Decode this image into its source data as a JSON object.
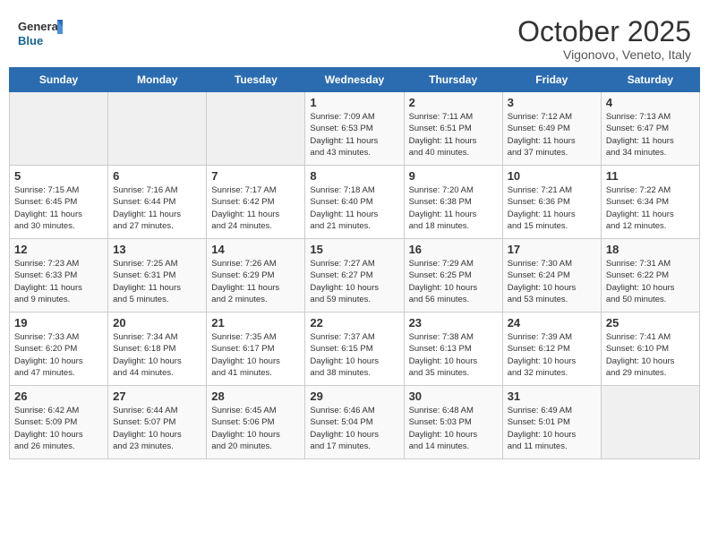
{
  "logo": {
    "line1": "General",
    "line2": "Blue"
  },
  "title": "October 2025",
  "subtitle": "Vigonovo, Veneto, Italy",
  "days_of_week": [
    "Sunday",
    "Monday",
    "Tuesday",
    "Wednesday",
    "Thursday",
    "Friday",
    "Saturday"
  ],
  "weeks": [
    [
      {
        "day": "",
        "info": ""
      },
      {
        "day": "",
        "info": ""
      },
      {
        "day": "",
        "info": ""
      },
      {
        "day": "1",
        "info": "Sunrise: 7:09 AM\nSunset: 6:53 PM\nDaylight: 11 hours\nand 43 minutes."
      },
      {
        "day": "2",
        "info": "Sunrise: 7:11 AM\nSunset: 6:51 PM\nDaylight: 11 hours\nand 40 minutes."
      },
      {
        "day": "3",
        "info": "Sunrise: 7:12 AM\nSunset: 6:49 PM\nDaylight: 11 hours\nand 37 minutes."
      },
      {
        "day": "4",
        "info": "Sunrise: 7:13 AM\nSunset: 6:47 PM\nDaylight: 11 hours\nand 34 minutes."
      }
    ],
    [
      {
        "day": "5",
        "info": "Sunrise: 7:15 AM\nSunset: 6:45 PM\nDaylight: 11 hours\nand 30 minutes."
      },
      {
        "day": "6",
        "info": "Sunrise: 7:16 AM\nSunset: 6:44 PM\nDaylight: 11 hours\nand 27 minutes."
      },
      {
        "day": "7",
        "info": "Sunrise: 7:17 AM\nSunset: 6:42 PM\nDaylight: 11 hours\nand 24 minutes."
      },
      {
        "day": "8",
        "info": "Sunrise: 7:18 AM\nSunset: 6:40 PM\nDaylight: 11 hours\nand 21 minutes."
      },
      {
        "day": "9",
        "info": "Sunrise: 7:20 AM\nSunset: 6:38 PM\nDaylight: 11 hours\nand 18 minutes."
      },
      {
        "day": "10",
        "info": "Sunrise: 7:21 AM\nSunset: 6:36 PM\nDaylight: 11 hours\nand 15 minutes."
      },
      {
        "day": "11",
        "info": "Sunrise: 7:22 AM\nSunset: 6:34 PM\nDaylight: 11 hours\nand 12 minutes."
      }
    ],
    [
      {
        "day": "12",
        "info": "Sunrise: 7:23 AM\nSunset: 6:33 PM\nDaylight: 11 hours\nand 9 minutes."
      },
      {
        "day": "13",
        "info": "Sunrise: 7:25 AM\nSunset: 6:31 PM\nDaylight: 11 hours\nand 5 minutes."
      },
      {
        "day": "14",
        "info": "Sunrise: 7:26 AM\nSunset: 6:29 PM\nDaylight: 11 hours\nand 2 minutes."
      },
      {
        "day": "15",
        "info": "Sunrise: 7:27 AM\nSunset: 6:27 PM\nDaylight: 10 hours\nand 59 minutes."
      },
      {
        "day": "16",
        "info": "Sunrise: 7:29 AM\nSunset: 6:25 PM\nDaylight: 10 hours\nand 56 minutes."
      },
      {
        "day": "17",
        "info": "Sunrise: 7:30 AM\nSunset: 6:24 PM\nDaylight: 10 hours\nand 53 minutes."
      },
      {
        "day": "18",
        "info": "Sunrise: 7:31 AM\nSunset: 6:22 PM\nDaylight: 10 hours\nand 50 minutes."
      }
    ],
    [
      {
        "day": "19",
        "info": "Sunrise: 7:33 AM\nSunset: 6:20 PM\nDaylight: 10 hours\nand 47 minutes."
      },
      {
        "day": "20",
        "info": "Sunrise: 7:34 AM\nSunset: 6:18 PM\nDaylight: 10 hours\nand 44 minutes."
      },
      {
        "day": "21",
        "info": "Sunrise: 7:35 AM\nSunset: 6:17 PM\nDaylight: 10 hours\nand 41 minutes."
      },
      {
        "day": "22",
        "info": "Sunrise: 7:37 AM\nSunset: 6:15 PM\nDaylight: 10 hours\nand 38 minutes."
      },
      {
        "day": "23",
        "info": "Sunrise: 7:38 AM\nSunset: 6:13 PM\nDaylight: 10 hours\nand 35 minutes."
      },
      {
        "day": "24",
        "info": "Sunrise: 7:39 AM\nSunset: 6:12 PM\nDaylight: 10 hours\nand 32 minutes."
      },
      {
        "day": "25",
        "info": "Sunrise: 7:41 AM\nSunset: 6:10 PM\nDaylight: 10 hours\nand 29 minutes."
      }
    ],
    [
      {
        "day": "26",
        "info": "Sunrise: 6:42 AM\nSunset: 5:09 PM\nDaylight: 10 hours\nand 26 minutes."
      },
      {
        "day": "27",
        "info": "Sunrise: 6:44 AM\nSunset: 5:07 PM\nDaylight: 10 hours\nand 23 minutes."
      },
      {
        "day": "28",
        "info": "Sunrise: 6:45 AM\nSunset: 5:06 PM\nDaylight: 10 hours\nand 20 minutes."
      },
      {
        "day": "29",
        "info": "Sunrise: 6:46 AM\nSunset: 5:04 PM\nDaylight: 10 hours\nand 17 minutes."
      },
      {
        "day": "30",
        "info": "Sunrise: 6:48 AM\nSunset: 5:03 PM\nDaylight: 10 hours\nand 14 minutes."
      },
      {
        "day": "31",
        "info": "Sunrise: 6:49 AM\nSunset: 5:01 PM\nDaylight: 10 hours\nand 11 minutes."
      },
      {
        "day": "",
        "info": ""
      }
    ]
  ]
}
